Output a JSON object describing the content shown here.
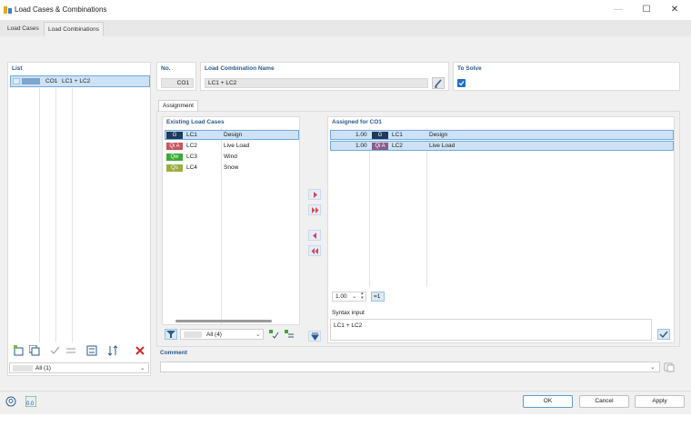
{
  "window": {
    "title": "Load Cases & Combinations"
  },
  "tabs": [
    {
      "label": "Load Cases"
    },
    {
      "label": "Load Combinations"
    }
  ],
  "list": {
    "header": "List",
    "items": [
      {
        "no": "CO1",
        "name": "LC1 + LC2"
      }
    ],
    "filter_value": "All (1)"
  },
  "details": {
    "no_label": "No.",
    "no_value": "CO1",
    "name_label": "Load Combination Name",
    "name_value": "LC1 + LC2",
    "to_solve_label": "To Solve",
    "to_solve_checked": true
  },
  "assignment": {
    "tab_label": "Assignment",
    "existing_header": "Existing Load Cases",
    "existing": [
      {
        "badge": "G",
        "badge_color": "#1f3a5c",
        "case": "LC1",
        "name": "Design"
      },
      {
        "badge": "Qi A",
        "badge_color": "#c9545f",
        "case": "LC2",
        "name": "Live Load"
      },
      {
        "badge": "Qw",
        "badge_color": "#3aaa35",
        "case": "LC3",
        "name": "Wind"
      },
      {
        "badge": "Qs",
        "badge_color": "#9aae3c",
        "case": "LC4",
        "name": "Snow"
      }
    ],
    "existing_filter": "All (4)",
    "assigned_header": "Assigned for CO1",
    "assigned": [
      {
        "factor": "1.00",
        "badge": "G",
        "badge_color": "#1f3a5c",
        "case": "LC1",
        "name": "Design"
      },
      {
        "factor": "1.00",
        "badge": "Qi A",
        "badge_color": "#8a5a8a",
        "case": "LC2",
        "name": "Live Load"
      }
    ],
    "factor_value": "1.00",
    "equals_label": "=1",
    "syntax_label": "Syntax input",
    "syntax_value": "LC1 + LC2"
  },
  "comment": {
    "label": "Comment",
    "value": ""
  },
  "buttons": {
    "ok": "OK",
    "cancel": "Cancel",
    "apply": "Apply"
  },
  "colors": {
    "accent": "#2a5a8c",
    "selection": "#cde3f5",
    "arrow": "#d64550"
  }
}
